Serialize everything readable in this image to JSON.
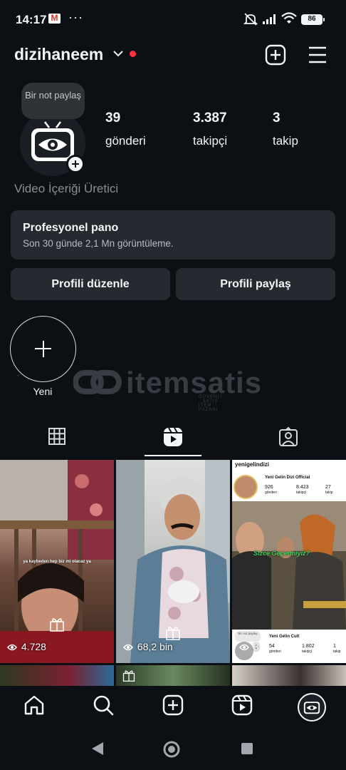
{
  "status_bar": {
    "time": "14:17",
    "battery": "86",
    "icons": [
      "gmail-icon",
      "more-dots-icon",
      "mute-icon",
      "signal-icon",
      "wifi-icon",
      "battery-icon"
    ]
  },
  "header": {
    "username": "dizihaneem",
    "icons": [
      "chevron-down-icon",
      "notification-dot",
      "create-icon",
      "menu-icon"
    ]
  },
  "profile": {
    "note": "Bir not paylaş",
    "stats": [
      {
        "value": "39",
        "label": "gönderi"
      },
      {
        "value": "3.387",
        "label": "takipçi"
      },
      {
        "value": "3",
        "label": "takip"
      }
    ],
    "bio": "Video İçeriği Üretici"
  },
  "pro_panel": {
    "title": "Profesyonel pano",
    "subtitle": "Son 30 günde 2,1 Mn görüntüleme."
  },
  "buttons": {
    "edit": "Profili düzenle",
    "share": "Profili paylaş"
  },
  "highlight": {
    "label": "Yeni"
  },
  "watermark": {
    "text": "itemsatis",
    "sub": "GÜVENLİ · SATIŞ · İTEM · PAZARI"
  },
  "tabs": [
    {
      "name": "grid",
      "icon": "grid-icon"
    },
    {
      "name": "reels",
      "icon": "reels-icon",
      "active": true
    },
    {
      "name": "tagged",
      "icon": "tagged-icon"
    }
  ],
  "posts": [
    {
      "views": "4.728",
      "caption": "ya kaybeden hep biz mi olacaz ya"
    },
    {
      "views": "68,2 bin"
    },
    {
      "account": "yenigelindizi",
      "profile_name": "Yeni Gelin Dizi Official",
      "stats": [
        {
          "value": "926",
          "label": "gönderi"
        },
        {
          "value": "8.423",
          "label": "takipçi"
        },
        {
          "value": "27",
          "label": "takip"
        }
      ],
      "overlay": "Sizce Geçermiyiz?",
      "second_profile": {
        "note": "Bir not paylaş",
        "name": "Yeni Gelin Cult",
        "stats": [
          {
            "value": "54",
            "label": "gönderi"
          },
          {
            "value": "1.802",
            "label": "takipçi"
          },
          {
            "value": "1",
            "label": "takip"
          }
        ]
      },
      "views": "3"
    }
  ],
  "bottom_nav": [
    "home-icon",
    "search-icon",
    "create-icon",
    "reels-icon",
    "profile-avatar"
  ],
  "colors": {
    "background": "#0c0f14",
    "surface": "#262a30",
    "text": "#f3f5f7",
    "muted": "#8a8e94",
    "notification": "#ff3040"
  }
}
